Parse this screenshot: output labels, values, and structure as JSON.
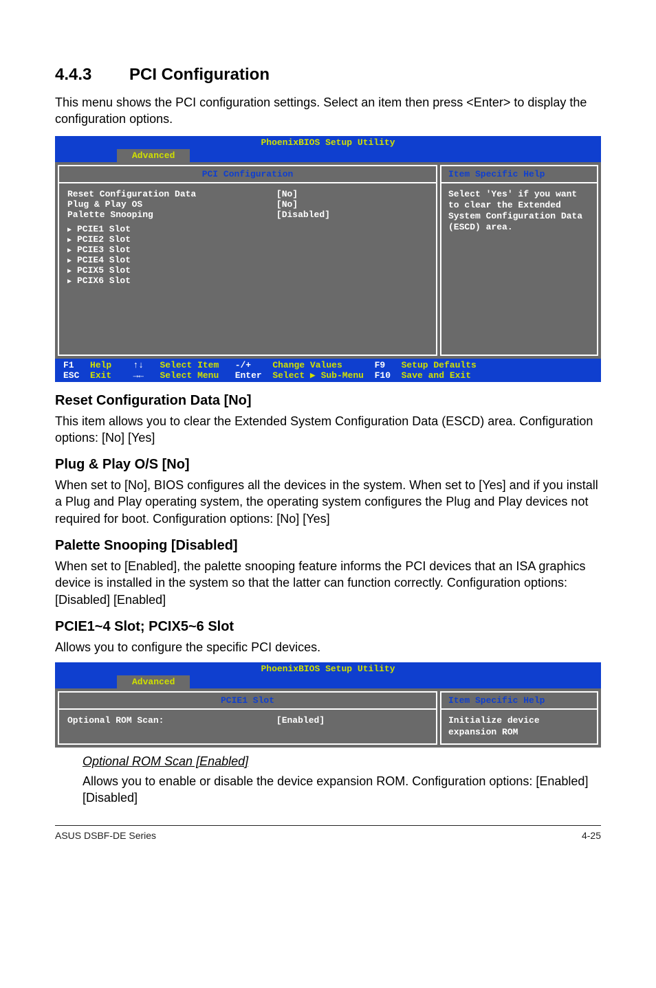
{
  "section": {
    "num": "4.4.3",
    "title": "PCI Configuration"
  },
  "intro": "This menu shows the PCI configuration settings. Select an item then press <Enter> to display the configuration options.",
  "bios1": {
    "title": "PhoenixBIOS Setup Utility",
    "tab": "Advanced",
    "left_header": "PCI Configuration",
    "items": {
      "reset": "Reset Configuration Data",
      "plug": "Plug & Play OS",
      "pal": "Palette Snooping"
    },
    "values": {
      "reset": "[No]",
      "plug": "[No]",
      "pal": "[Disabled]"
    },
    "slots": [
      "PCIE1 Slot",
      "PCIE2 Slot",
      "PCIE3 Slot",
      "PCIE4 Slot",
      "PCIX5 Slot",
      "PCIX6 Slot"
    ],
    "help_header": "Item Specific Help",
    "help": "Select 'Yes' if you want to clear the Extended System Configuration Data (ESCD) area.",
    "foot": {
      "f1": "F1",
      "help": "Help",
      "ud": "↑↓",
      "selitem": "Select Item",
      "pm": "-/+",
      "chg": "Change Values",
      "f9": "F9",
      "def": "Setup Defaults",
      "esc": "ESC",
      "exit": "Exit",
      "lr": "→←",
      "selmenu": "Select Menu",
      "ent": "Enter",
      "sub": "Select ▶ Sub-Menu",
      "f10": "F10",
      "save": "Save and Exit"
    }
  },
  "reset": {
    "h": "Reset Configuration Data [No]",
    "p": "This item allows you to clear the Extended System Configuration Data (ESCD) area. Configuration options: [No] [Yes]"
  },
  "plug": {
    "h": "Plug & Play O/S [No]",
    "p": "When set to [No], BIOS configures all the devices in the system. When set to [Yes] and if you install a Plug and Play operating system, the operating system configures the Plug and Play devices not required for boot. Configuration options: [No] [Yes]"
  },
  "pal": {
    "h": "Palette Snooping [Disabled]",
    "p": "When set to [Enabled], the palette snooping feature informs the PCI devices that an ISA graphics device is installed in the system so that the latter can function correctly. Configuration options: [Disabled] [Enabled]"
  },
  "slot": {
    "h": "PCIE1~4 Slot; PCIX5~6 Slot",
    "p": "Allows you to configure the specific PCI devices."
  },
  "bios2": {
    "title": "PhoenixBIOS Setup Utility",
    "tab": "Advanced",
    "left_header": "PCIE1 Slot",
    "item": "Optional ROM Scan:",
    "value": "[Enabled]",
    "help_header": "Item Specific Help",
    "help": "Initialize device expansion ROM"
  },
  "opt": {
    "h": "Optional ROM Scan [Enabled]",
    "p": "Allows you to enable or disable the device expansion ROM. Configuration options: [Enabled] [Disabled]"
  },
  "footer": {
    "left": "ASUS DSBF-DE Series",
    "right": "4-25"
  }
}
